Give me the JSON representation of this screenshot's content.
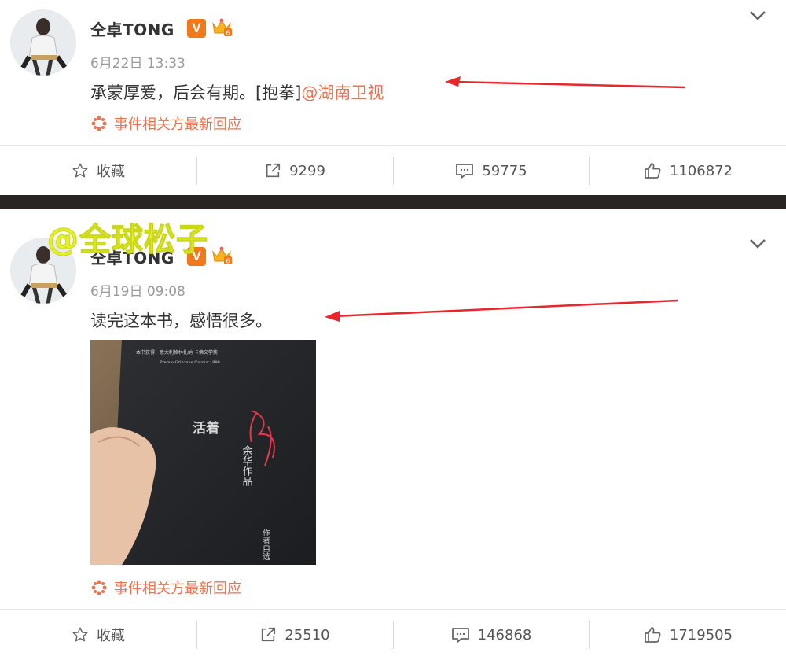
{
  "posts": [
    {
      "username": "仝卓TONG",
      "vip_badge": "V",
      "time": "6月22日 13:33",
      "content_text": "承蒙厚爱，后会有期。[抱拳]",
      "mention": "@湖南卫视",
      "event_link": "事件相关方最新回应",
      "actions": {
        "favorite": "收藏",
        "repost": "9299",
        "comment": "59775",
        "like": "1106872"
      }
    },
    {
      "username": "仝卓TONG",
      "vip_badge": "V",
      "time": "6月19日 09:08",
      "content_text": "读完这本书，感悟很多。",
      "event_link": "事件相关方最新回应",
      "actions": {
        "favorite": "收藏",
        "repost": "25510",
        "comment": "146868",
        "like": "1719505"
      },
      "photo_text": {
        "top_line": "本书获得：意大利格林扎纳·卡佛文学奖",
        "top_sub": "Premio Grinzane Cavour 1998",
        "title": "活着",
        "author": "余华作品",
        "bottom": "作者自选"
      }
    }
  ],
  "watermark": "@全球松子",
  "colors": {
    "accent": "#eb7350",
    "vip": "#f2781c",
    "arrow": "#e8262b",
    "watermark": "#e8f22a"
  },
  "icons": [
    "chevron-down-icon",
    "star-icon",
    "repost-icon",
    "comment-icon",
    "like-icon",
    "crown-icon",
    "event-icon"
  ]
}
